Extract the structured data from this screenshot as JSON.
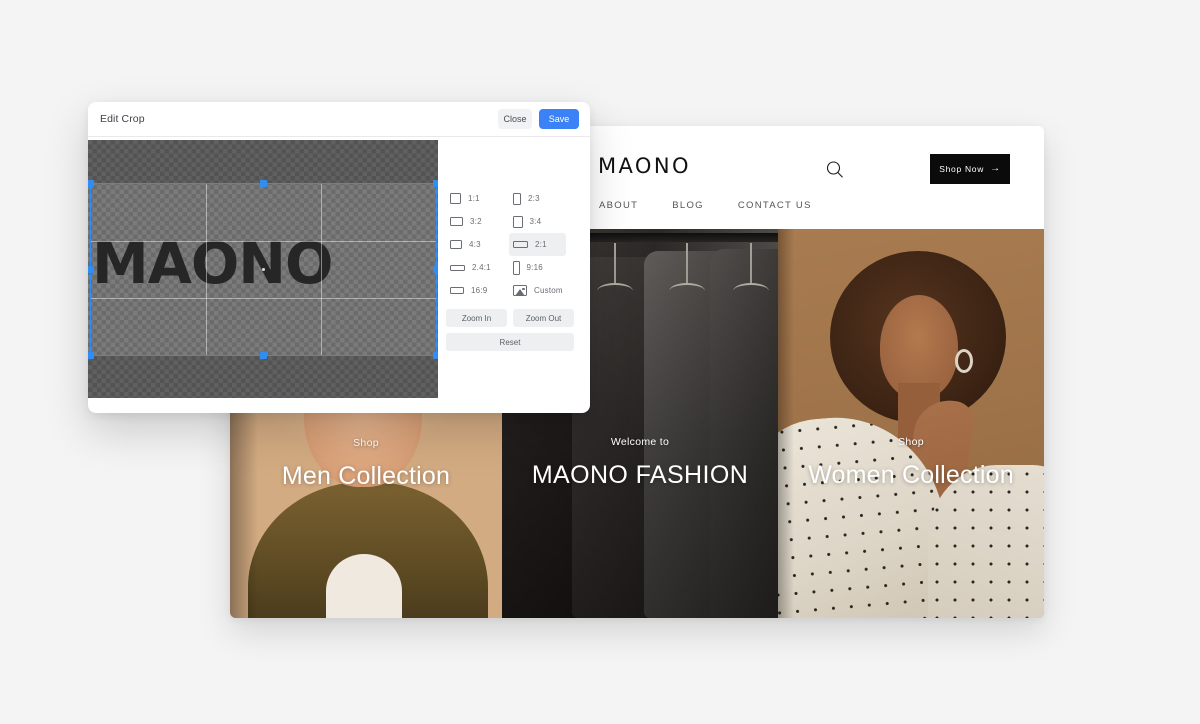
{
  "dialog": {
    "title": "Edit Crop",
    "close_label": "Close",
    "save_label": "Save",
    "accent_color": "#3b82f6",
    "canvas": {
      "logo_text": "MAONO",
      "selection_ratio": "2:1"
    },
    "ratios": [
      {
        "label": "1:1",
        "icon": "ratio-1-1-icon",
        "selected": false
      },
      {
        "label": "2:3",
        "icon": "ratio-2-3-icon",
        "selected": false
      },
      {
        "label": "3:2",
        "icon": "ratio-3-2-icon",
        "selected": false
      },
      {
        "label": "3:4",
        "icon": "ratio-3-4-icon",
        "selected": false
      },
      {
        "label": "4:3",
        "icon": "ratio-4-3-icon",
        "selected": false
      },
      {
        "label": "2:1",
        "icon": "ratio-2-1-icon",
        "selected": true
      },
      {
        "label": "2.4:1",
        "icon": "ratio-24-1-icon",
        "selected": false
      },
      {
        "label": "9:16",
        "icon": "ratio-9-16-icon",
        "selected": false
      },
      {
        "label": "16:9",
        "icon": "ratio-16-9-icon",
        "selected": false
      },
      {
        "label": "Custom",
        "icon": "ratio-custom-icon",
        "selected": false
      }
    ],
    "zoom_in_label": "Zoom In",
    "zoom_out_label": "Zoom Out",
    "reset_label": "Reset"
  },
  "site": {
    "brand": "MAONO",
    "nav": [
      {
        "label": "ABOUT"
      },
      {
        "label": "BLOG"
      },
      {
        "label": "CONTACT US"
      }
    ],
    "search_icon": "search-icon",
    "shop_now": {
      "label": "Shop Now",
      "arrow": "→",
      "background": "#0b0b0b"
    },
    "hero": [
      {
        "eyebrow": "Shop",
        "title": "Men Collection"
      },
      {
        "eyebrow": "Welcome to",
        "title": "MAONO FASHION"
      },
      {
        "eyebrow": "Shop",
        "title": "Women Collection"
      }
    ]
  }
}
